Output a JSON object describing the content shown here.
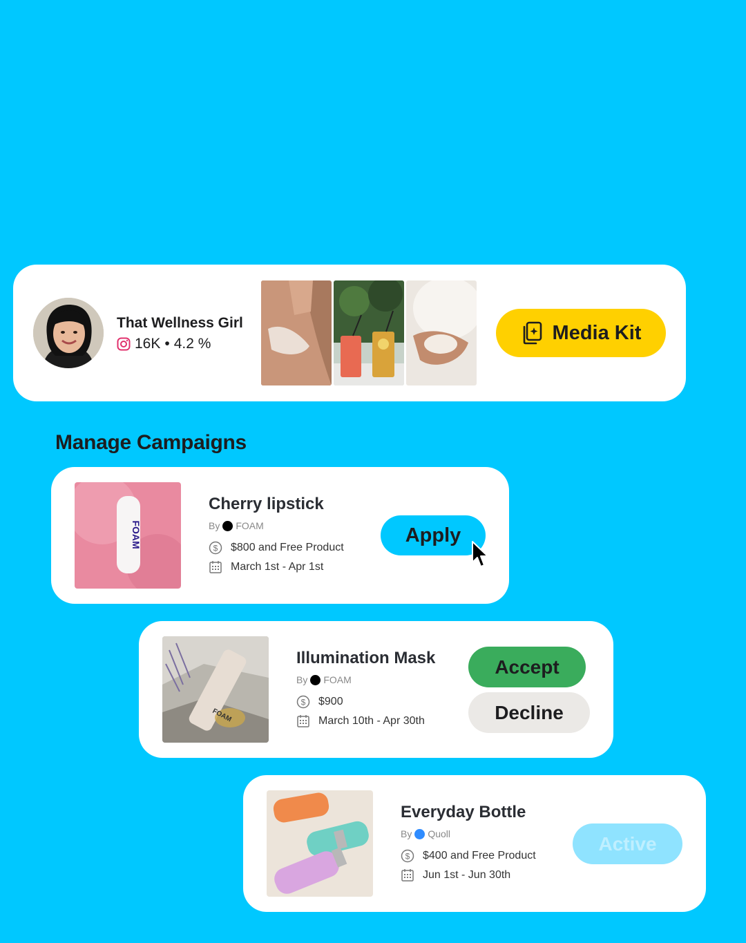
{
  "profile": {
    "name": "That Wellness Girl",
    "followers": "16K",
    "separator": "•",
    "engagement": "4.2 %",
    "media_kit_label": "Media Kit"
  },
  "section_title": "Manage Campaigns",
  "campaigns": [
    {
      "title": "Cherry lipstick",
      "by": "By",
      "brand": "FOAM",
      "brand_color": "#000000",
      "payment": "$800 and Free Product",
      "dates": "March 1st - Apr 1st",
      "action": "Apply"
    },
    {
      "title": "Illumination Mask",
      "by": "By",
      "brand": "FOAM",
      "brand_color": "#000000",
      "payment": "$900",
      "dates": "March 10th - Apr 30th",
      "accept_label": "Accept",
      "decline_label": "Decline"
    },
    {
      "title": "Everyday Bottle",
      "by": "By",
      "brand": "Quoll",
      "brand_color": "#2f8cff",
      "payment": "$400 and Free Product",
      "dates": "Jun 1st - Jun 30th",
      "status": "Active"
    }
  ],
  "colors": {
    "background": "#00c8ff",
    "media_kit": "#ffd000",
    "apply": "#00c8ff",
    "accept": "#3aac5c",
    "decline": "#ebe9e6",
    "active": "#8fe3ff"
  },
  "icons": {
    "instagram": "instagram-icon",
    "media_kit": "media-kit-icon",
    "payment": "dollar-circle-icon",
    "date": "calendar-icon",
    "cursor": "mouse-cursor-icon"
  }
}
